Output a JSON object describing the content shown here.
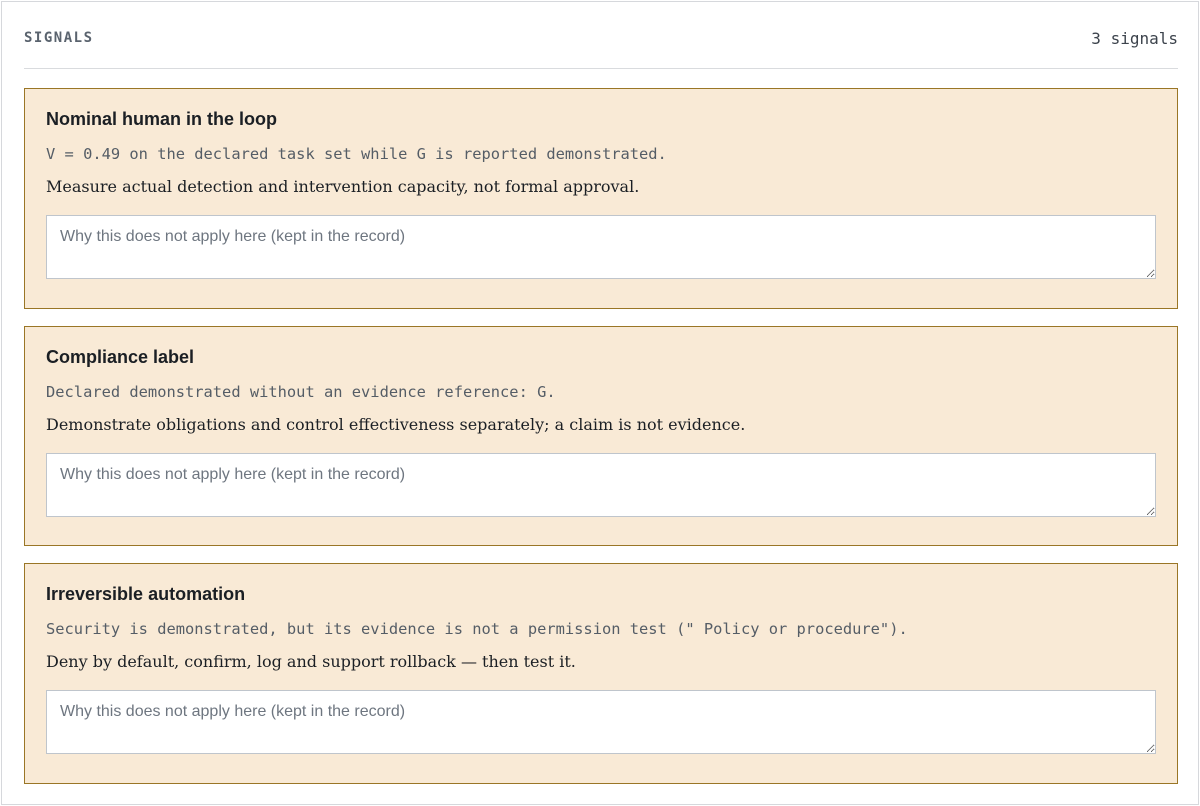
{
  "header": {
    "title": "SIGNALS",
    "count_label": "3 signals"
  },
  "signals": [
    {
      "title": "Nominal human in the loop",
      "detail": "V = 0.49 on the declared task set while G is reported demonstrated.",
      "guidance": "Measure actual detection and intervention capacity, not formal approval.",
      "note_value": "",
      "note_placeholder": "Why this does not apply here (kept in the record)"
    },
    {
      "title": "Compliance label",
      "detail": "Declared demonstrated without an evidence reference: G.",
      "guidance": "Demonstrate obligations and control effectiveness separately; a claim is not evidence.",
      "note_value": "",
      "note_placeholder": "Why this does not apply here (kept in the record)"
    },
    {
      "title": "Irreversible automation",
      "detail": "Security is demonstrated, but its evidence is not a permission test (\" Policy or procedure\").",
      "guidance": "Deny by default, confirm, log and support rollback — then test it.",
      "note_value": "",
      "note_placeholder": "Why this does not apply here (kept in the record)"
    }
  ],
  "colors": {
    "card_background": "#f9ead6",
    "card_border": "#9a7626"
  }
}
